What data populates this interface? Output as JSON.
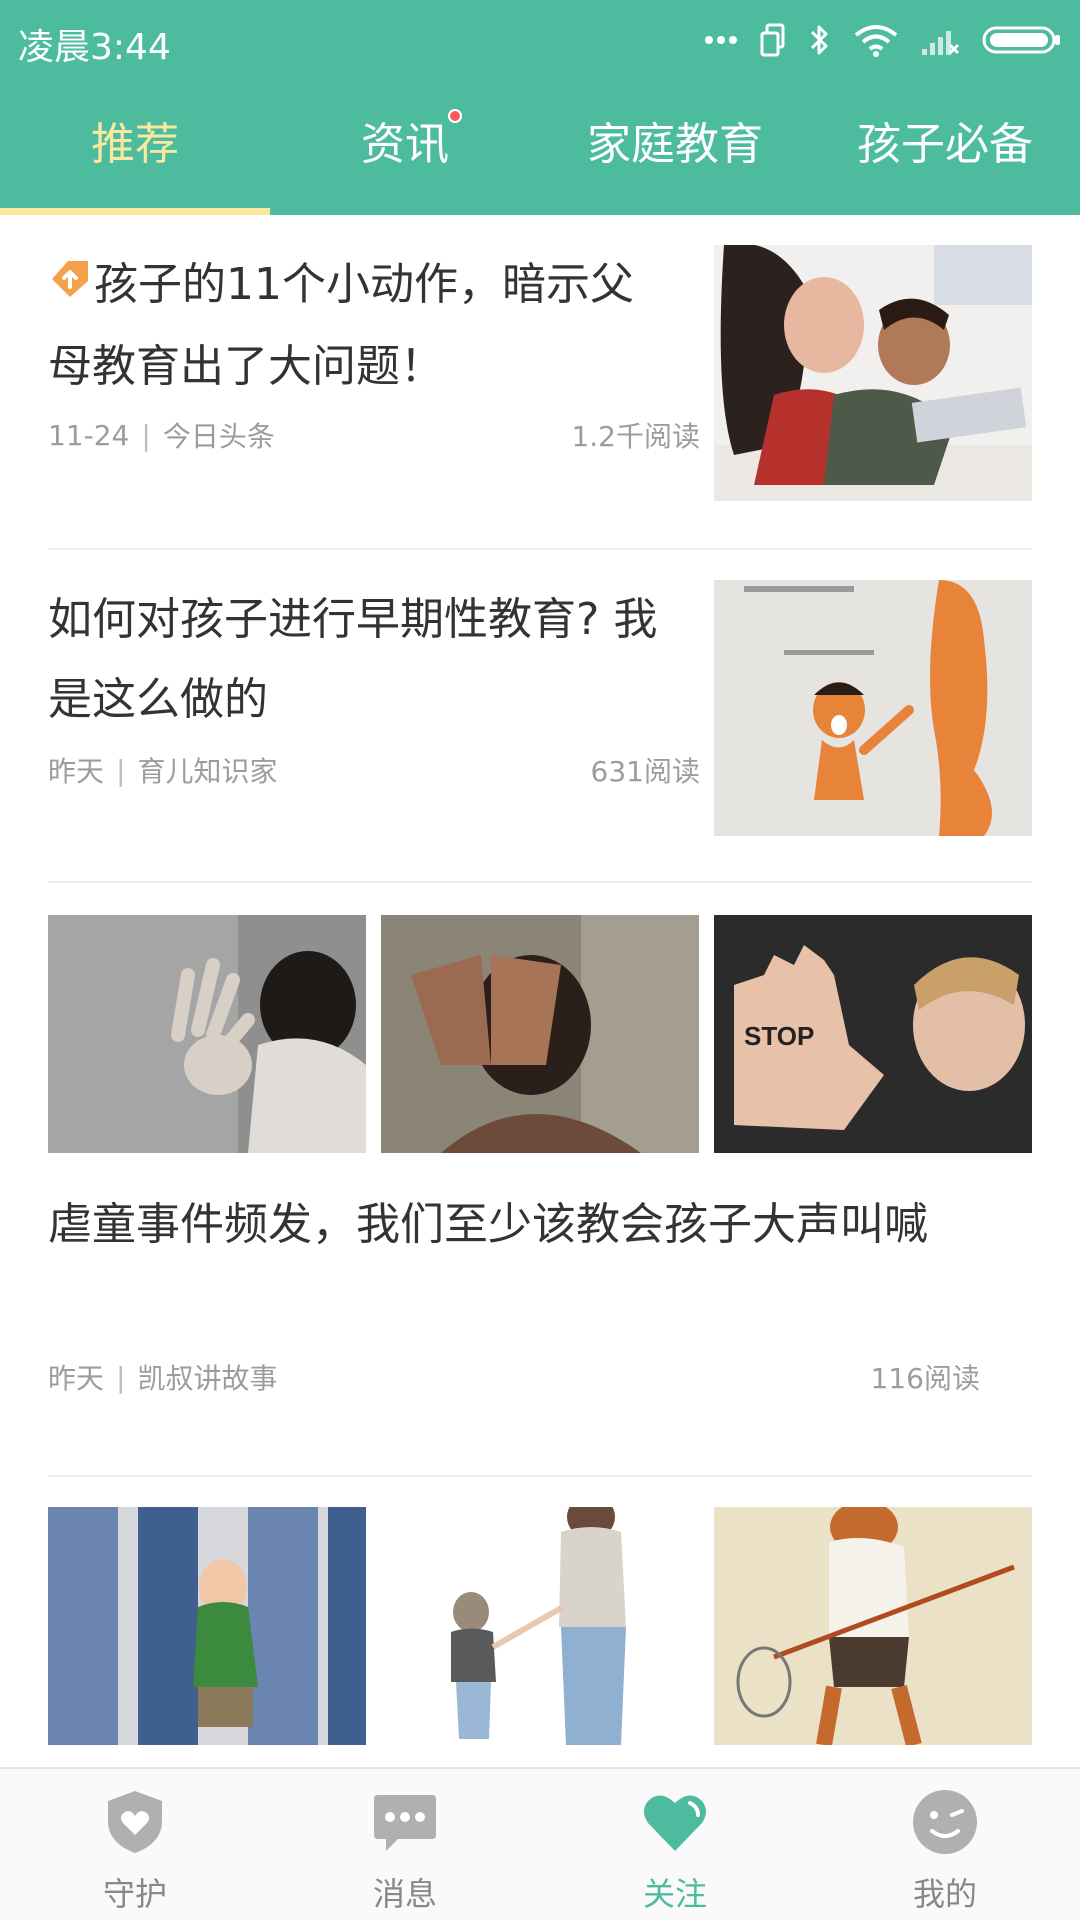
{
  "status_bar": {
    "time": "凌晨3:44"
  },
  "tabs": [
    {
      "label": "推荐",
      "active": true
    },
    {
      "label": "资讯",
      "has_dot": true
    },
    {
      "label": "家庭教育"
    },
    {
      "label": "孩子必备"
    }
  ],
  "articles": [
    {
      "title": "孩子的11个小动作，暗示父母教育出了大问题！",
      "is_top": true,
      "date": "11-24",
      "source": "今日头条",
      "reads": "1.2千阅读"
    },
    {
      "title": "如何对孩子进行早期性教育? 我是这么做的",
      "date": "昨天",
      "source": "育儿知识家",
      "reads": "631阅读"
    },
    {
      "title": "虐童事件频发，我们至少该教会孩子大声叫喊",
      "date": "昨天",
      "source": "凯叔讲故事",
      "reads": "116阅读",
      "image_texts": [
        "STOP"
      ]
    }
  ],
  "bottom_nav": [
    {
      "label": "守护",
      "icon": "shield-heart-icon"
    },
    {
      "label": "消息",
      "icon": "chat-bubble-icon"
    },
    {
      "label": "关注",
      "icon": "heart-icon",
      "active": true
    },
    {
      "label": "我的",
      "icon": "smiley-icon"
    }
  ],
  "colors": {
    "brand_green": "#4dbc9e",
    "active_tab": "#fbe8a0",
    "badge_red": "#ff5a5a",
    "top_badge_orange": "#f5a04a"
  }
}
